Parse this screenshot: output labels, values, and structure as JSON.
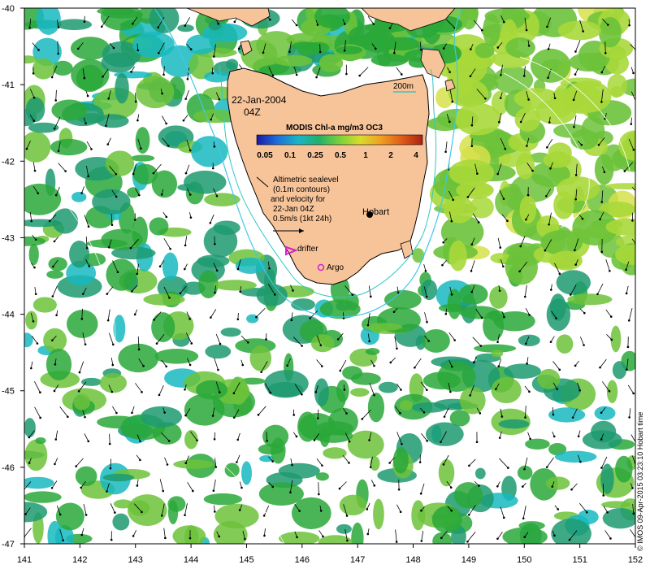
{
  "map": {
    "date_label": "22-Jan-2004",
    "time_label": "04Z",
    "depth_contour_label": "200m",
    "colorbar": {
      "title": "MODIS Chl-a mg/m3 OC3",
      "ticks": [
        "0.05",
        "0.1",
        "0.25",
        "0.5",
        "1",
        "2",
        "4"
      ],
      "colors": [
        "#1a1aa8",
        "#1d6fd8",
        "#19b5c8",
        "#23b06a",
        "#7ad13a",
        "#d8dc2a",
        "#f0a020",
        "#e05a1a",
        "#a82310"
      ]
    },
    "legend_text": [
      "Altimetric sealevel",
      "(0.1m contours)",
      "and velocity for",
      "22-Jan 04Z",
      "0.5m/s (1kt 24h)"
    ],
    "place_labels": {
      "hobart": "Hobart",
      "drifter": "drifter",
      "argo": "Argo"
    },
    "x_axis": {
      "ticks": [
        "141",
        "142",
        "143",
        "144",
        "145",
        "146",
        "147",
        "148",
        "149",
        "150",
        "151",
        "152"
      ]
    },
    "y_axis": {
      "ticks": [
        "-40",
        "-41",
        "-42",
        "-43",
        "-44",
        "-45",
        "-46",
        "-47"
      ]
    },
    "credit": "© IMOS 09-Apr-2015 03:23:10 Hobart time",
    "land_color": "#f7c49a",
    "ocean_colors": [
      "#2aa838",
      "#6cc23a",
      "#a8d83a",
      "#d6e04a",
      "#1d9a70",
      "#18b8c0"
    ],
    "marker_colors": {
      "drifter": "#d020d0",
      "argo": "#d020d0",
      "contour": "#3fc8e8",
      "depth": "#30c8c0"
    }
  }
}
